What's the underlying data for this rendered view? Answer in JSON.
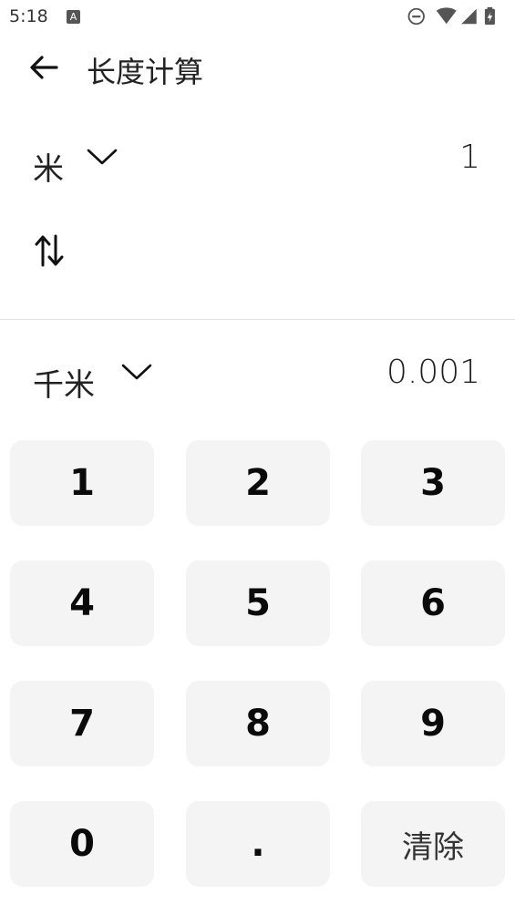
{
  "status_bar": {
    "time": "5:18",
    "notification_icon": "A"
  },
  "app_bar": {
    "title": "长度计算"
  },
  "from": {
    "unit": "米",
    "value": "1"
  },
  "to": {
    "unit": "千米",
    "value": "0.001"
  },
  "keypad": {
    "k1": "1",
    "k2": "2",
    "k3": "3",
    "k4": "4",
    "k5": "5",
    "k6": "6",
    "k7": "7",
    "k8": "8",
    "k9": "9",
    "k0": "0",
    "kdot": ".",
    "kclear": "清除"
  }
}
